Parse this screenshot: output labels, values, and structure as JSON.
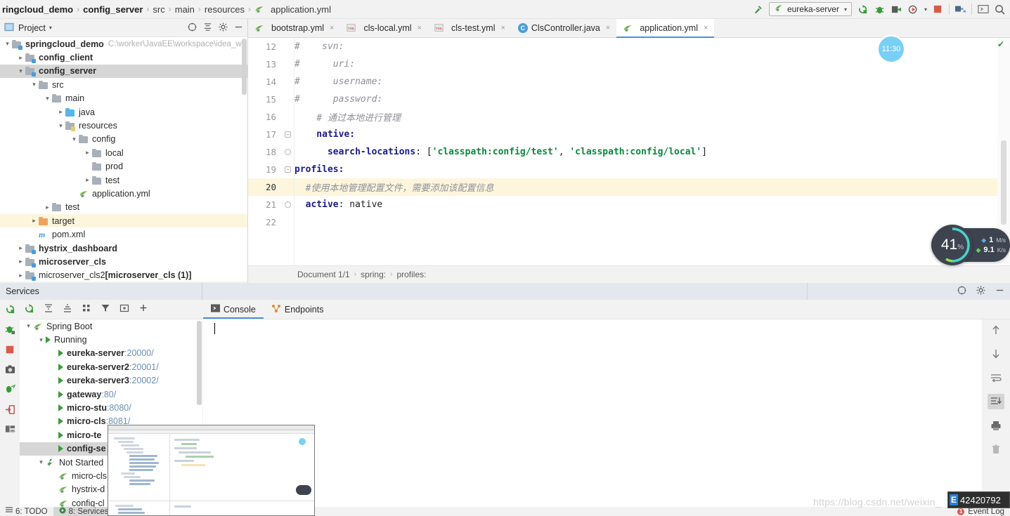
{
  "breadcrumb": {
    "items": [
      {
        "label": "ringcloud_demo",
        "bold": true
      },
      {
        "label": "config_server",
        "bold": true
      },
      {
        "label": "src",
        "bold": false
      },
      {
        "label": "main",
        "bold": false
      },
      {
        "label": "resources",
        "bold": false
      },
      {
        "label": "application.yml",
        "bold": false,
        "icon": "spring-yml-icon"
      }
    ],
    "separator": "›"
  },
  "toolbar": {
    "hammer_icon": "build-hammer-icon",
    "run_config": {
      "label": "eureka-server",
      "icon": "spring-boot-icon",
      "caret": "▾"
    },
    "icons": [
      {
        "name": "rerun-icon",
        "color": "#3a9c3a"
      },
      {
        "name": "debug-icon",
        "color": "#3a9c3a"
      },
      {
        "name": "run-with-coverage-icon",
        "color": "#4a4a4a"
      },
      {
        "name": "profile-icon",
        "color": "#4a4a4a"
      },
      {
        "name": "stop-icon",
        "color": "#d85c4a"
      },
      {
        "name": "project-structure-icon",
        "color": "#4a6b8a"
      },
      {
        "name": "terminal-icon",
        "color": "#4a4a4a"
      },
      {
        "name": "search-everywhere-icon",
        "color": "#4a4a4a"
      }
    ]
  },
  "project_panel": {
    "title": "Project",
    "caret": "▾",
    "header_icons": [
      "target-icon",
      "collapse-all-icon",
      "gear-icon",
      "minimize-icon"
    ],
    "tree": [
      {
        "indent": 0,
        "arrow": "down",
        "icon": "module-folder-icon",
        "label": "springcloud_demo",
        "bold": true,
        "note": "C:\\worker\\JavaEE\\workspace\\idea_w",
        "state": "normal"
      },
      {
        "indent": 1,
        "arrow": "right",
        "icon": "module-folder-icon",
        "label": "config_client",
        "bold": true,
        "note": "",
        "state": "normal"
      },
      {
        "indent": 1,
        "arrow": "down",
        "icon": "module-folder-icon",
        "label": "config_server",
        "bold": true,
        "note": "",
        "state": "selected"
      },
      {
        "indent": 2,
        "arrow": "down",
        "icon": "folder-icon",
        "label": "src",
        "bold": false,
        "note": "",
        "state": "normal"
      },
      {
        "indent": 3,
        "arrow": "down",
        "icon": "folder-icon",
        "label": "main",
        "bold": false,
        "note": "",
        "state": "normal"
      },
      {
        "indent": 4,
        "arrow": "right",
        "icon": "source-folder-icon",
        "label": "java",
        "bold": false,
        "note": "",
        "state": "normal"
      },
      {
        "indent": 4,
        "arrow": "down",
        "icon": "resource-folder-icon",
        "label": "resources",
        "bold": false,
        "note": "",
        "state": "normal"
      },
      {
        "indent": 5,
        "arrow": "down",
        "icon": "folder-icon",
        "label": "config",
        "bold": false,
        "note": "",
        "state": "normal"
      },
      {
        "indent": 6,
        "arrow": "right",
        "icon": "folder-icon",
        "label": "local",
        "bold": false,
        "note": "",
        "state": "normal"
      },
      {
        "indent": 6,
        "arrow": "none",
        "icon": "folder-icon",
        "label": "prod",
        "bold": false,
        "note": "",
        "state": "normal"
      },
      {
        "indent": 6,
        "arrow": "right",
        "icon": "folder-icon",
        "label": "test",
        "bold": false,
        "note": "",
        "state": "normal"
      },
      {
        "indent": 5,
        "arrow": "none",
        "icon": "spring-yml-icon",
        "label": "application.yml",
        "bold": false,
        "note": "",
        "state": "normal"
      },
      {
        "indent": 3,
        "arrow": "right",
        "icon": "folder-icon",
        "label": "test",
        "bold": false,
        "note": "",
        "state": "normal"
      },
      {
        "indent": 2,
        "arrow": "right",
        "icon": "target-folder-icon",
        "label": "target",
        "bold": false,
        "note": "",
        "state": "highlight"
      },
      {
        "indent": 2,
        "arrow": "none",
        "icon": "maven-icon",
        "label": "pom.xml",
        "bold": false,
        "note": "",
        "state": "normal"
      },
      {
        "indent": 1,
        "arrow": "right",
        "icon": "module-folder-icon",
        "label": "hystrix_dashboard",
        "bold": true,
        "note": "",
        "state": "normal"
      },
      {
        "indent": 1,
        "arrow": "right",
        "icon": "module-folder-icon",
        "label": "microserver_cls",
        "bold": true,
        "note": "",
        "state": "normal"
      },
      {
        "indent": 1,
        "arrow": "right",
        "icon": "module-folder-icon",
        "label": "microserver_cls2",
        "bold": false,
        "note": "[microserver_cls (1)]",
        "state": "normal"
      }
    ]
  },
  "editor": {
    "tabs": [
      {
        "label": "bootstrap.yml",
        "icon": "spring-yml-icon",
        "active": false,
        "close": "×"
      },
      {
        "label": "cls-local.yml",
        "icon": "yml-icon",
        "active": false,
        "close": "×"
      },
      {
        "label": "cls-test.yml",
        "icon": "yml-icon",
        "active": false,
        "close": "×"
      },
      {
        "label": "ClsController.java",
        "icon": "java-class-icon",
        "active": false,
        "close": "×"
      },
      {
        "label": "application.yml",
        "icon": "spring-yml-icon",
        "active": true,
        "close": "×"
      }
    ],
    "lines": [
      {
        "num": "12",
        "fold": "",
        "highlight": false,
        "tokens": [
          {
            "t": "#",
            "c": "comment"
          },
          {
            "t": "    svn:",
            "c": "comment"
          }
        ]
      },
      {
        "num": "13",
        "fold": "",
        "highlight": false,
        "tokens": [
          {
            "t": "#",
            "c": "comment"
          },
          {
            "t": "      uri:",
            "c": "comment"
          }
        ]
      },
      {
        "num": "14",
        "fold": "",
        "highlight": false,
        "tokens": [
          {
            "t": "#",
            "c": "comment"
          },
          {
            "t": "      username:",
            "c": "comment"
          }
        ]
      },
      {
        "num": "15",
        "fold": "",
        "highlight": false,
        "tokens": [
          {
            "t": "#",
            "c": "comment"
          },
          {
            "t": "      password:",
            "c": "comment"
          }
        ]
      },
      {
        "num": "16",
        "fold": "",
        "highlight": false,
        "tokens": [
          {
            "t": "    # 通过本地进行管理",
            "c": "comment"
          }
        ]
      },
      {
        "num": "17",
        "fold": "open",
        "highlight": false,
        "tokens": [
          {
            "t": "    native:",
            "c": "key"
          }
        ]
      },
      {
        "num": "18",
        "fold": "end",
        "highlight": false,
        "tokens": [
          {
            "t": "      search-locations",
            "c": "key"
          },
          {
            "t": ": [",
            "c": "plain"
          },
          {
            "t": "'classpath:config/test'",
            "c": "str"
          },
          {
            "t": ", ",
            "c": "plain"
          },
          {
            "t": "'classpath:config/local'",
            "c": "str"
          },
          {
            "t": "]",
            "c": "plain"
          }
        ]
      },
      {
        "num": "19",
        "fold": "open",
        "highlight": false,
        "tokens": [
          {
            "t": "profiles:",
            "c": "key"
          }
        ]
      },
      {
        "num": "20",
        "fold": "",
        "highlight": true,
        "tokens": [
          {
            "t": "  #使用本地管理配置文件，需要添加该配置信息",
            "c": "comment"
          }
        ]
      },
      {
        "num": "21",
        "fold": "end",
        "highlight": false,
        "tokens": [
          {
            "t": "  active",
            "c": "key"
          },
          {
            "t": ": native",
            "c": "plain"
          }
        ]
      },
      {
        "num": "22",
        "fold": "",
        "highlight": false,
        "tokens": []
      }
    ],
    "inspection_status": "✔",
    "bottom_breadcrumb": [
      "Document 1/1",
      "spring:",
      "profiles:"
    ],
    "bottom_breadcrumb_sep": "›"
  },
  "services": {
    "window_title": "Services",
    "header_icons": [
      "target-icon",
      "gear-icon",
      "minimize-icon"
    ],
    "left_toolstrip_icons": [
      "rerun-icon",
      "debug-icon",
      "stop-icon",
      "camera-icon",
      "attach-debugger-icon",
      "exit-icon",
      "layout-icon"
    ],
    "toolbar_icons": [
      "refresh-icon",
      "expand-all-icon",
      "collapse-all-icon",
      "group-icon",
      "filter-icon",
      "add-tab-icon",
      "plus-icon"
    ],
    "tree": [
      {
        "indent": 0,
        "arrow": "down",
        "icon": "spring-boot-icon",
        "label": "Spring Boot",
        "bold": false,
        "port": "",
        "state": "normal"
      },
      {
        "indent": 1,
        "arrow": "down",
        "icon": "run-green-icon",
        "label": "Running",
        "bold": false,
        "port": "",
        "state": "normal"
      },
      {
        "indent": 2,
        "arrow": "none",
        "icon": "run-green-icon",
        "label": "eureka-server",
        "bold": true,
        "port": ":20000/",
        "state": "normal"
      },
      {
        "indent": 2,
        "arrow": "none",
        "icon": "run-green-icon",
        "label": "eureka-server2",
        "bold": true,
        "port": ":20001/",
        "state": "normal"
      },
      {
        "indent": 2,
        "arrow": "none",
        "icon": "run-green-icon",
        "label": "eureka-server3",
        "bold": true,
        "port": ":20002/",
        "state": "normal"
      },
      {
        "indent": 2,
        "arrow": "none",
        "icon": "run-green-icon",
        "label": "gateway",
        "bold": true,
        "port": ":80/",
        "state": "normal"
      },
      {
        "indent": 2,
        "arrow": "none",
        "icon": "run-green-icon",
        "label": "micro-stu",
        "bold": true,
        "port": ":8080/",
        "state": "normal"
      },
      {
        "indent": 2,
        "arrow": "none",
        "icon": "run-green-icon",
        "label": "micro-cls",
        "bold": true,
        "port": ":8081/",
        "state": "normal"
      },
      {
        "indent": 2,
        "arrow": "none",
        "icon": "run-green-icon",
        "label": "micro-te",
        "bold": true,
        "port": "",
        "state": "normal"
      },
      {
        "indent": 2,
        "arrow": "none",
        "icon": "run-green-icon",
        "label": "config-se",
        "bold": true,
        "port": "",
        "state": "selected"
      },
      {
        "indent": 1,
        "arrow": "down",
        "icon": "wrench-icon",
        "label": "Not Started",
        "bold": false,
        "port": "",
        "state": "normal"
      },
      {
        "indent": 2,
        "arrow": "none",
        "icon": "spring-boot-icon",
        "label": "micro-cls",
        "bold": false,
        "port": "",
        "state": "normal"
      },
      {
        "indent": 2,
        "arrow": "none",
        "icon": "spring-boot-icon",
        "label": "hystrix-d",
        "bold": false,
        "port": "",
        "state": "normal"
      },
      {
        "indent": 2,
        "arrow": "none",
        "icon": "spring-boot-icon",
        "label": "config-cl",
        "bold": false,
        "port": "",
        "state": "normal"
      }
    ],
    "console_tabs": [
      {
        "label": "Console",
        "icon": "console-icon",
        "active": true
      },
      {
        "label": "Endpoints",
        "icon": "endpoints-icon",
        "active": false
      }
    ],
    "console_right_icons": [
      "scroll-up-icon",
      "scroll-down-icon",
      "soft-wrap-icon",
      "scroll-to-end-icon",
      "print-icon",
      "trash-icon"
    ]
  },
  "statusbar": {
    "items": [
      {
        "label": "6: TODO",
        "icon": "todo-icon",
        "active": false
      },
      {
        "label": "8: Services",
        "icon": "services-icon",
        "active": true
      }
    ],
    "event_log": {
      "label": "Event Log",
      "badge": "1"
    }
  },
  "overlays": {
    "clock": "11:30",
    "cpu_monitor": {
      "value": "41",
      "unit": "%"
    },
    "network": {
      "upload_value": "1",
      "upload_unit": "M/s",
      "download_value": "9.1",
      "download_unit": "K/s",
      "up_arrow": "▲",
      "down_arrow": "▼"
    },
    "ime_input": {
      "badge": "E",
      "text": "42420792"
    },
    "watermark": "https://blog.csdn.net/weixin_"
  }
}
